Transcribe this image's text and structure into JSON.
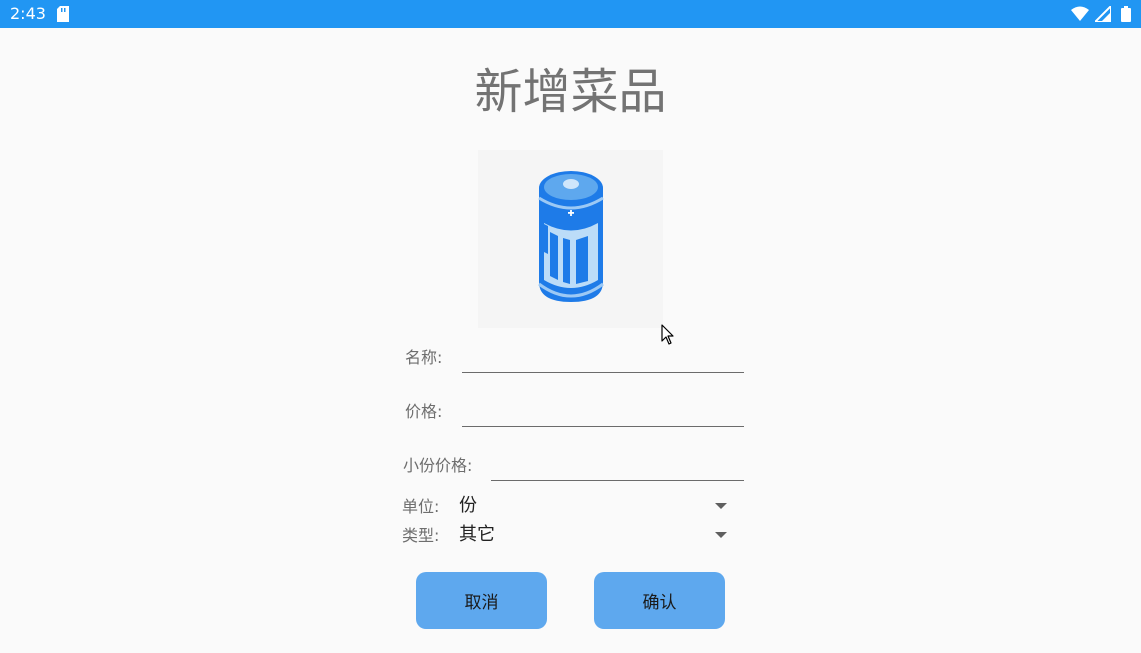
{
  "status_bar": {
    "time": "2:43",
    "icons": [
      "sd-card-icon",
      "wifi-icon",
      "signal-icon",
      "battery-icon"
    ],
    "color": "#2196f3"
  },
  "page": {
    "title": "新增菜品",
    "image_icon": "battery-icon"
  },
  "form": {
    "name_label": "名称:",
    "name_value": "",
    "price_label": "价格:",
    "price_value": "",
    "small_price_label": "小份价格:",
    "small_price_value": "",
    "unit_label": "单位:",
    "unit_value": "份",
    "type_label": "类型:",
    "type_value": "其它"
  },
  "buttons": {
    "cancel_label": "取消",
    "confirm_label": "确认",
    "color": "#5ea8ee"
  }
}
